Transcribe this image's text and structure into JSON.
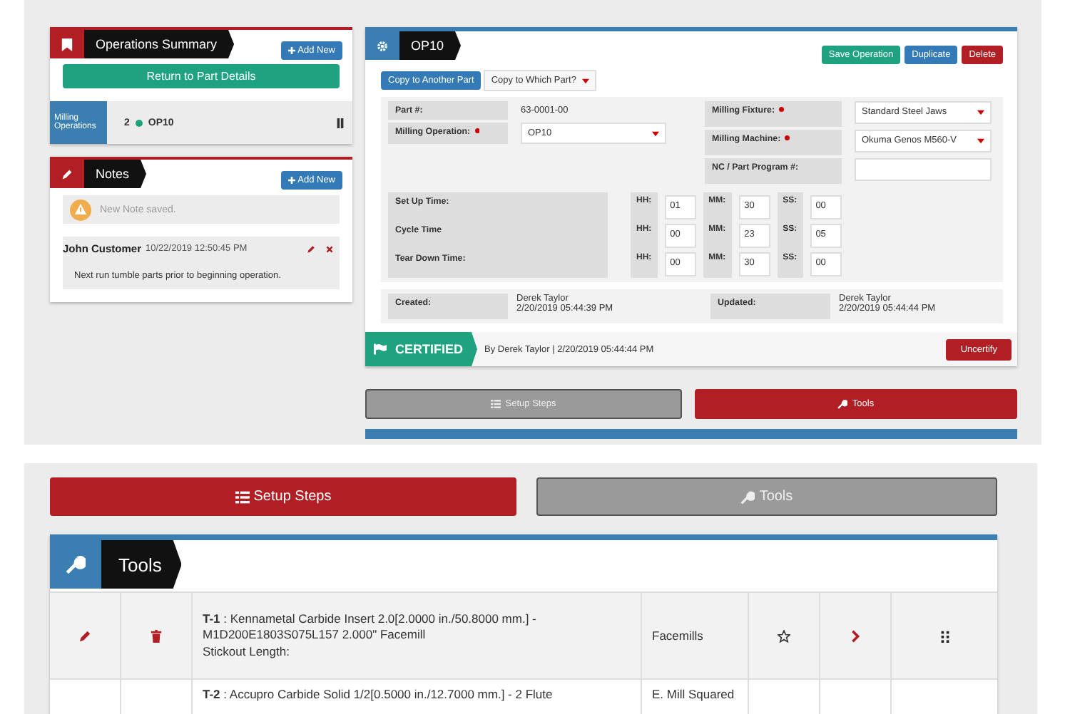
{
  "top": {
    "operations_summary": {
      "title": "Operations Summary",
      "add_button": "Add New",
      "return_button": "Return to Part Details",
      "group_label": "Milling Operations",
      "operations": [
        {
          "number": "2",
          "name": "OP10",
          "color": "#1aa37a"
        }
      ]
    },
    "notes": {
      "title": "Notes",
      "add_button": "Add New",
      "alert": "New Note saved.",
      "items": [
        {
          "author": "John Customer",
          "time": "10/22/2019 12:50:45 PM",
          "text": "Next run tumble parts prior to beginning operation."
        }
      ]
    },
    "operation": {
      "title": "OP10",
      "save_button": "Save Operation",
      "duplicate_button": "Duplicate",
      "delete_button": "Delete",
      "copy_button": "Copy to Another Part",
      "copy_select": "Copy to Which Part?",
      "part_label": "Part #:",
      "part_value": "63-0001-00",
      "left_fields": [
        {
          "label": "Milling Operation:",
          "required": true,
          "value": "OP10"
        }
      ],
      "right_fields": [
        {
          "label": "Milling Fixture:",
          "required": true,
          "kind": "select",
          "value": "Standard Steel Jaws"
        },
        {
          "label": "Milling Machine:",
          "required": true,
          "kind": "select",
          "value": "Okuma Genos M560-V"
        },
        {
          "label": "NC / Part Program #:",
          "required": false,
          "kind": "input"
        }
      ],
      "times": [
        {
          "label": "Set Up Time:",
          "units": [
            {
              "label": "HH:",
              "value": "01"
            },
            {
              "label": "MM:",
              "value": "30"
            },
            {
              "label": "SS:",
              "value": "00"
            }
          ]
        },
        {
          "label": "Cycle Time",
          "units": [
            {
              "label": "HH:",
              "value": "00"
            },
            {
              "label": "MM:",
              "value": "23"
            },
            {
              "label": "SS:",
              "value": "05"
            }
          ]
        },
        {
          "label": "Tear Down Time:",
          "units": [
            {
              "label": "HH:",
              "value": "00"
            },
            {
              "label": "MM:",
              "value": "30"
            },
            {
              "label": "SS:",
              "value": "00"
            }
          ]
        }
      ],
      "created_label": "Created:",
      "created_by": "Derek Taylor",
      "created_at": "2/20/2019 05:44:39 PM",
      "updated_label": "Updated:",
      "updated_by": "Derek Taylor",
      "updated_at": "2/20/2019 05:44:44 PM",
      "certified": true,
      "certified_label": "CERTIFIED",
      "certified_info": "By Derek Taylor | 2/20/2019 05:44:44 PM",
      "uncertify_button": "Uncertify"
    },
    "nav_buttons": [
      {
        "label": "Setup Steps",
        "kind": "list",
        "selected": true
      },
      {
        "label": "Tools",
        "kind": "wrench",
        "selected": false
      }
    ]
  },
  "bottom": {
    "nav_buttons": [
      {
        "label": "Setup Steps",
        "kind": "list",
        "selected": false
      },
      {
        "label": "Tools",
        "kind": "wrench",
        "selected": true
      }
    ],
    "tools_panel": {
      "title": "Tools",
      "rows": [
        {
          "description": "**T-1** : Kennametal Carbide Insert 2.0[2.0000 in./50.8000 mm.] - M1D200E1803S075L157 2.000\" Facemill",
          "extra": "Stickout Length:",
          "category": "Facemills"
        },
        {
          "description": "**T-2** : Accupro Carbide Solid 1/2[0.5000 in./12.7000 mm.] - 2 Flute",
          "category": "E. Mill Squared"
        }
      ]
    }
  }
}
